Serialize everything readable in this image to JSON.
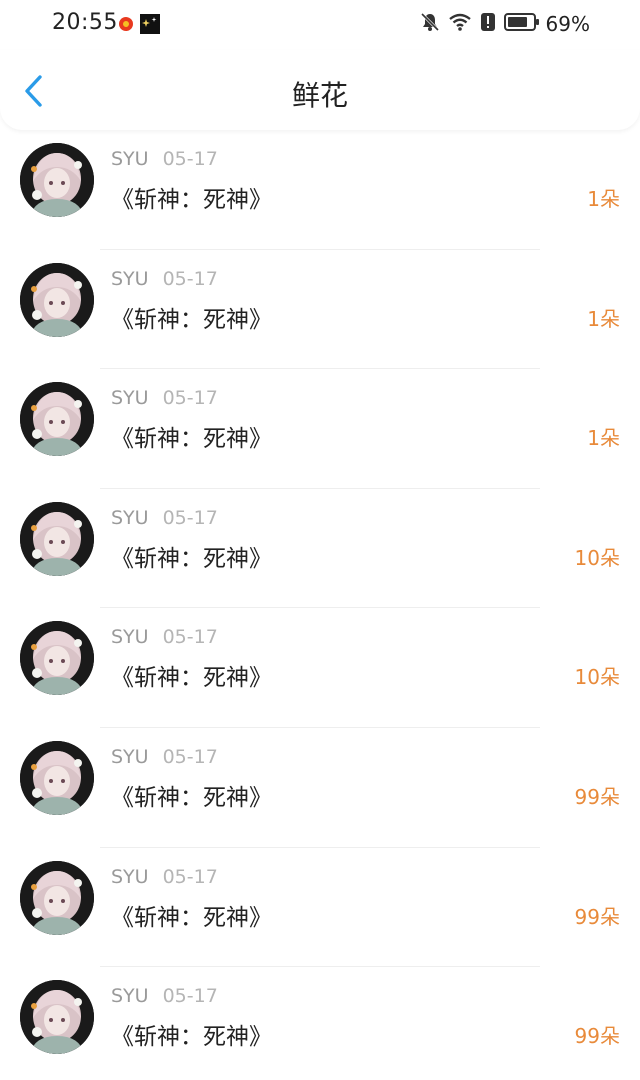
{
  "status_bar": {
    "time": "20:55",
    "battery": "69%"
  },
  "header": {
    "title": "鲜花"
  },
  "records": [
    {
      "user": "SYU",
      "date": "05-17",
      "book": "《斩神：死神》",
      "count": "1朵"
    },
    {
      "user": "SYU",
      "date": "05-17",
      "book": "《斩神：死神》",
      "count": "1朵"
    },
    {
      "user": "SYU",
      "date": "05-17",
      "book": "《斩神：死神》",
      "count": "1朵"
    },
    {
      "user": "SYU",
      "date": "05-17",
      "book": "《斩神：死神》",
      "count": "10朵"
    },
    {
      "user": "SYU",
      "date": "05-17",
      "book": "《斩神：死神》",
      "count": "10朵"
    },
    {
      "user": "SYU",
      "date": "05-17",
      "book": "《斩神：死神》",
      "count": "99朵"
    },
    {
      "user": "SYU",
      "date": "05-17",
      "book": "《斩神：死神》",
      "count": "99朵"
    },
    {
      "user": "SYU",
      "date": "05-17",
      "book": "《斩神：死神》",
      "count": "99朵"
    }
  ],
  "colors": {
    "accent_back": "#2a9be8",
    "count_orange": "#e88a3a"
  }
}
